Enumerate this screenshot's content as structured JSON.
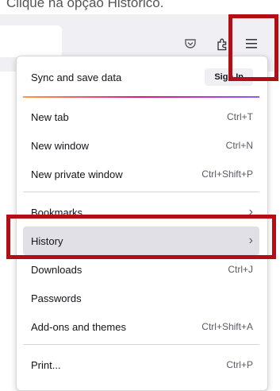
{
  "caption": "Clique na opção Histórico.",
  "toolbar": {
    "icons": [
      "pocket-icon",
      "extensions-icon",
      "hamburger-menu-icon"
    ]
  },
  "menu": {
    "sync_label": "Sync and save data",
    "signin_label": "Sign In",
    "new_tab": "New tab",
    "new_tab_shortcut": "Ctrl+T",
    "new_window": "New window",
    "new_window_shortcut": "Ctrl+N",
    "new_private_window": "New private window",
    "new_private_window_shortcut": "Ctrl+Shift+P",
    "bookmarks": "Bookmarks",
    "history": "History",
    "downloads": "Downloads",
    "downloads_shortcut": "Ctrl+J",
    "passwords": "Passwords",
    "addons": "Add-ons and themes",
    "addons_shortcut": "Ctrl+Shift+A",
    "print": "Print...",
    "print_shortcut": "Ctrl+P"
  },
  "colors": {
    "highlight": "#b30d15",
    "hover_row": "#e0e0e6",
    "toolbar_bg": "#f0f0f4"
  }
}
